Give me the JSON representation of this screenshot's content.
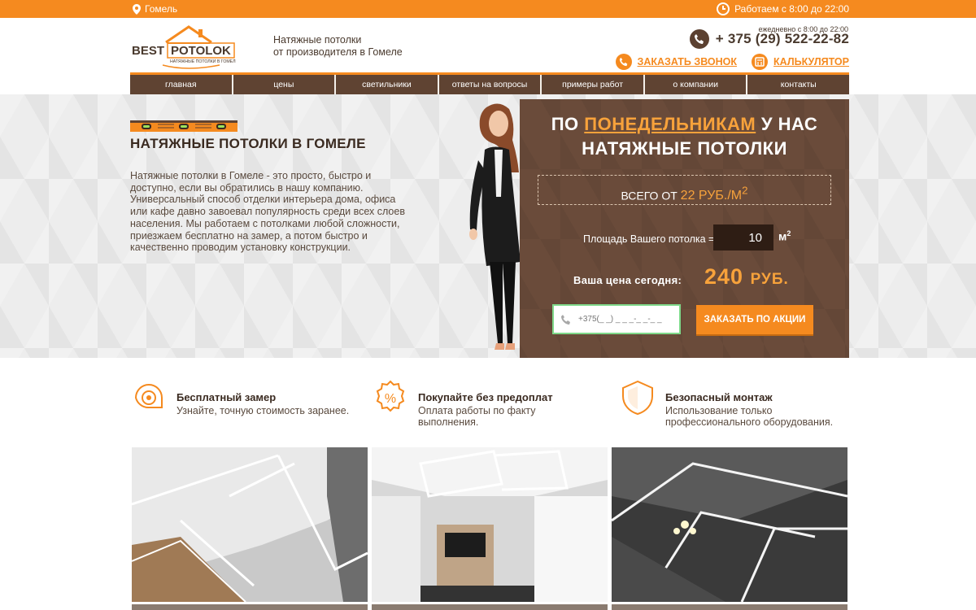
{
  "topbar": {
    "city": "Гомель",
    "hours": "Работаем с 8:00 до 22:00"
  },
  "header": {
    "logo_text_1": "BEST",
    "logo_text_2": "POTOLOK",
    "logo_sub": "НАТЯЖНЫЕ ПОТОЛКИ В ГОМЕЛЕ",
    "tagline_1": "Натяжные потолки",
    "tagline_2": "от производителя в Гомеле",
    "daily": "ежедневно с 8:00 до 22:00",
    "phone": "+ 375 (29) 522-22-82",
    "call_label": "ЗАКАЗАТЬ ЗВОНОК",
    "calc_label": "КАЛЬКУЛЯТОР"
  },
  "nav": [
    "главная",
    "цены",
    "светильники",
    "ответы на вопросы",
    "примеры работ",
    "о компании",
    "контакты"
  ],
  "hero": {
    "title": "НАТЯЖНЫЕ ПОТОЛКИ В ГОМЕЛЕ",
    "text": "Натяжные потолки в Гомеле - это просто, быстро и доступно, если вы обратились в нашу компанию. Универсальный способ отделки интерьера дома, офиса или кафе давно завоевал популярность среди всех слоев населения. Мы работаем с потолками любой сложности, приезжаем бесплатно на замер, а потом быстро и качественно проводим установку конструкции."
  },
  "promo": {
    "title_pre": "ПО ",
    "title_hl": "ПОНЕДЕЛЬНИКАМ",
    "title_post": " У НАС",
    "title_2": "НАТЯЖНЫЕ ПОТОЛКИ",
    "price_pre": "ВСЕГО ОТ ",
    "price_value": "22 РУБ./М",
    "price_sup": "2",
    "area_label": "Площадь Вашего потолка =",
    "area_value": "10",
    "area_unit": "м",
    "area_unit_sup": "2",
    "today_label": "Ваша цена сегодня:",
    "today_price": "240",
    "today_currency": "РУБ.",
    "phone_placeholder": "+375(_ _) _ _ _-_ _-_ _",
    "order_label": "ЗАКАЗАТЬ ПО АКЦИИ"
  },
  "features": [
    {
      "title": "Бесплатный замер",
      "desc_1": "Узнайте, точную стоимость заранее.",
      "desc_2": "",
      "icon": "tape-measure-icon"
    },
    {
      "title": "Покупайте без предоплат",
      "desc_1": "Оплата работы по факту",
      "desc_2": "выполнения.",
      "icon": "percent-badge-icon"
    },
    {
      "title": "Безопасный монтаж",
      "desc_1": "Использование только",
      "desc_2": "профессионального оборудования.",
      "icon": "shield-icon"
    }
  ],
  "colors": {
    "accent": "#f58a1f",
    "brown": "#5f4332",
    "promo_bg": "#6a4b3a",
    "highlight": "#f7a23b"
  }
}
